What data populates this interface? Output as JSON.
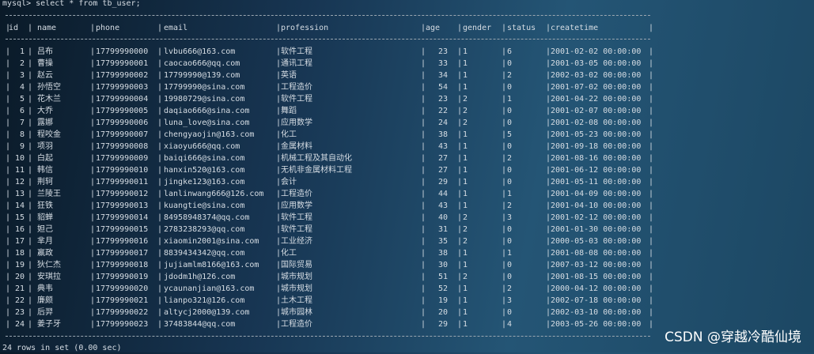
{
  "prompt": "mysql> select * from tb_user;",
  "columns": [
    "id",
    "name",
    "phone",
    "email",
    "profession",
    "age",
    "gender",
    "status",
    "createtime"
  ],
  "rows": [
    [
      "1",
      "吕布",
      "17799990000",
      "lvbu666@163.com",
      "软件工程",
      "23",
      "1",
      "6",
      "2001-02-02 00:00:00"
    ],
    [
      "2",
      "曹操",
      "17799990001",
      "caocao666@qq.com",
      "通讯工程",
      "33",
      "1",
      "0",
      "2001-03-05 00:00:00"
    ],
    [
      "3",
      "赵云",
      "17799990002",
      "17799990@139.com",
      "英语",
      "34",
      "1",
      "2",
      "2002-03-02 00:00:00"
    ],
    [
      "4",
      "孙悟空",
      "17799990003",
      "17799990@sina.com",
      "工程造价",
      "54",
      "1",
      "0",
      "2001-07-02 00:00:00"
    ],
    [
      "5",
      "花木兰",
      "17799990004",
      "19980729@sina.com",
      "软件工程",
      "23",
      "2",
      "1",
      "2001-04-22 00:00:00"
    ],
    [
      "6",
      "大乔",
      "17799990005",
      "daqiao666@sina.com",
      "舞蹈",
      "22",
      "2",
      "0",
      "2001-02-07 00:00:00"
    ],
    [
      "7",
      "露娜",
      "17799990006",
      "luna_love@sina.com",
      "应用数学",
      "24",
      "2",
      "0",
      "2001-02-08 00:00:00"
    ],
    [
      "8",
      "程咬金",
      "17799990007",
      "chengyaojin@163.com",
      "化工",
      "38",
      "1",
      "5",
      "2001-05-23 00:00:00"
    ],
    [
      "9",
      "项羽",
      "17799990008",
      "xiaoyu666@qq.com",
      "金属材料",
      "43",
      "1",
      "0",
      "2001-09-18 00:00:00"
    ],
    [
      "10",
      "白起",
      "17799990009",
      "baiqi666@sina.com",
      "机械工程及其自动化",
      "27",
      "1",
      "2",
      "2001-08-16 00:00:00"
    ],
    [
      "11",
      "韩信",
      "17799990010",
      "hanxin520@163.com",
      "无机非金属材料工程",
      "27",
      "1",
      "0",
      "2001-06-12 00:00:00"
    ],
    [
      "12",
      "荆轲",
      "17799990011",
      "jingke123@163.com",
      "会计",
      "29",
      "1",
      "0",
      "2001-05-11 00:00:00"
    ],
    [
      "13",
      "兰陵王",
      "17799990012",
      "lanlinwang666@126.com",
      "工程造价",
      "44",
      "1",
      "1",
      "2001-04-09 00:00:00"
    ],
    [
      "14",
      "狂铁",
      "17799990013",
      "kuangtie@sina.com",
      "应用数学",
      "43",
      "1",
      "2",
      "2001-04-10 00:00:00"
    ],
    [
      "15",
      "貂蝉",
      "17799990014",
      "84958948374@qq.com",
      "软件工程",
      "40",
      "2",
      "3",
      "2001-02-12 00:00:00"
    ],
    [
      "16",
      "妲己",
      "17799990015",
      "2783238293@qq.com",
      "软件工程",
      "31",
      "2",
      "0",
      "2001-01-30 00:00:00"
    ],
    [
      "17",
      "芈月",
      "17799990016",
      "xiaomin2001@sina.com",
      "工业经济",
      "35",
      "2",
      "0",
      "2000-05-03 00:00:00"
    ],
    [
      "18",
      "嬴政",
      "17799990017",
      "8839434342@qq.com",
      "化工",
      "38",
      "1",
      "1",
      "2001-08-08 00:00:00"
    ],
    [
      "19",
      "狄仁杰",
      "17799990018",
      "jujiamlm8166@163.com",
      "国际贸易",
      "30",
      "1",
      "0",
      "2007-03-12 00:00:00"
    ],
    [
      "20",
      "安琪拉",
      "17799990019",
      "jdodm1h@126.com",
      "城市规划",
      "51",
      "2",
      "0",
      "2001-08-15 00:00:00"
    ],
    [
      "21",
      "典韦",
      "17799990020",
      "ycaunanjian@163.com",
      "城市规划",
      "52",
      "1",
      "2",
      "2000-04-12 00:00:00"
    ],
    [
      "22",
      "廉颇",
      "17799990021",
      "lianpo321@126.com",
      "土木工程",
      "19",
      "1",
      "3",
      "2002-07-18 00:00:00"
    ],
    [
      "23",
      "后羿",
      "17799990022",
      "altycj2000@139.com",
      "城市园林",
      "20",
      "1",
      "0",
      "2002-03-10 00:00:00"
    ],
    [
      "24",
      "姜子牙",
      "17799990023",
      "37483844@qq.com",
      "工程造价",
      "29",
      "1",
      "4",
      "2003-05-26 00:00:00"
    ]
  ],
  "footer": "24 rows in set (0.00 sec)",
  "watermark": "CSDN @穿越冷酷仙境"
}
